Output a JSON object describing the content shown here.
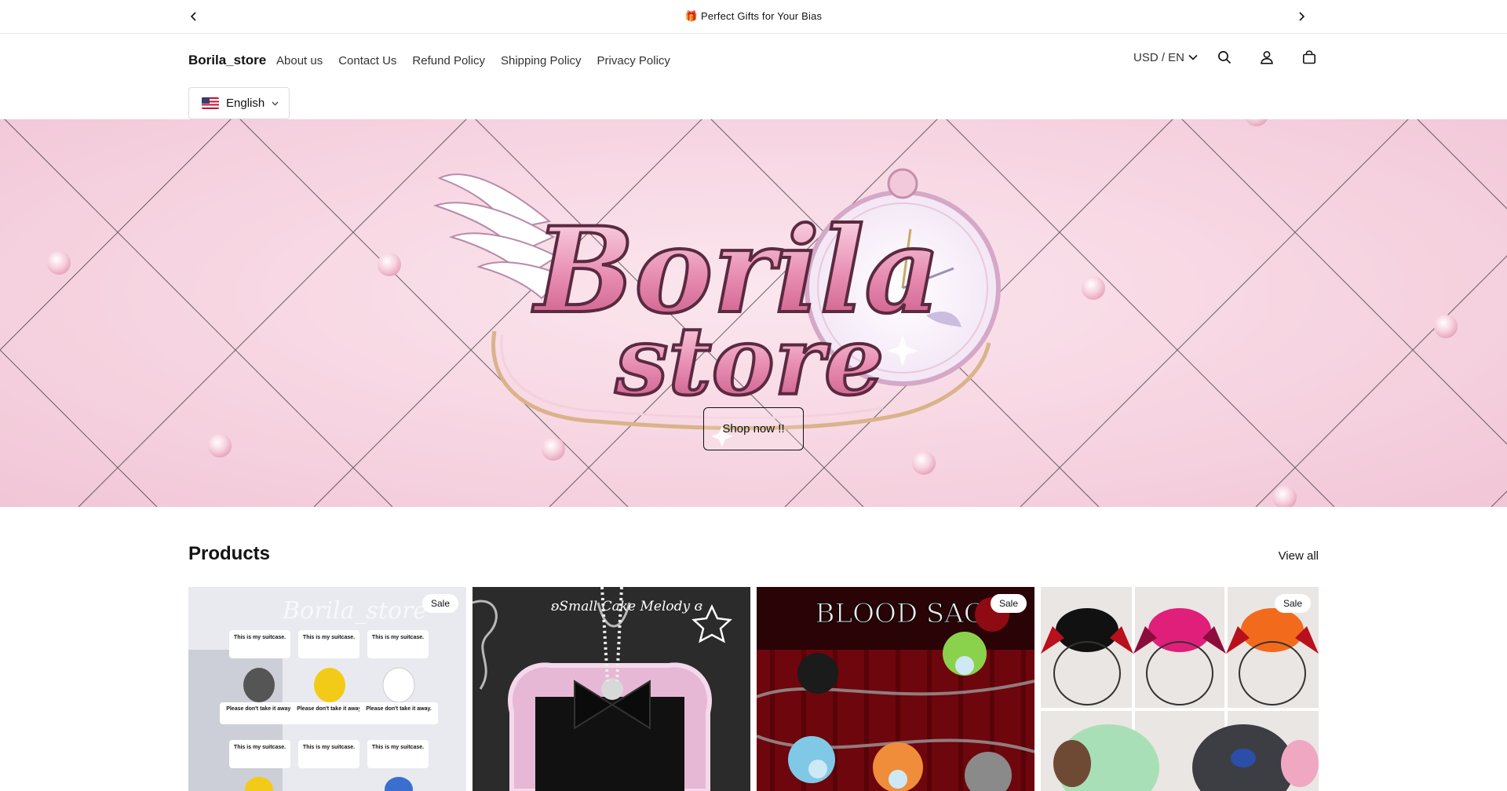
{
  "announcement": {
    "message": "🎁 Perfect Gifts for Your Bias",
    "prev_icon": "chevron-left-icon",
    "next_icon": "chevron-right-icon"
  },
  "header": {
    "logo": "Borila_store",
    "nav": [
      "About us",
      "Contact Us",
      "Refund Policy",
      "Shipping Policy",
      "Privacy Policy"
    ],
    "currency_label": "USD / EN",
    "icons": [
      "search-icon",
      "account-icon",
      "cart-icon"
    ]
  },
  "language": {
    "flag": "🇺🇸",
    "selected": "English"
  },
  "hero": {
    "logo_line1": "Borila",
    "logo_line2": "store",
    "cta": "Shop now !!"
  },
  "products": {
    "title": "Products",
    "view_all": "View all",
    "items": [
      {
        "badge": "Sale",
        "image_caption": "Borila_store",
        "tags": [
          "This is my suitcase.",
          "This is my suitcase.",
          "This is my suitcase.",
          "Please don't take it away.",
          "Please don't take it away.",
          "Please don't take it away.",
          "This is my suitcase.",
          "This is my suitcase.",
          "This is my suitcase."
        ]
      },
      {
        "badge": "",
        "image_caption": "ʚSmall Cake Melody ɞ"
      },
      {
        "badge": "Sale",
        "image_caption": "BLOOD SAGA"
      },
      {
        "badge": "Sale",
        "image_caption": ""
      }
    ]
  },
  "colors": {
    "hero_pink": "#f6d3e0",
    "text": "#121212",
    "blood_red": "#8b0a12"
  }
}
